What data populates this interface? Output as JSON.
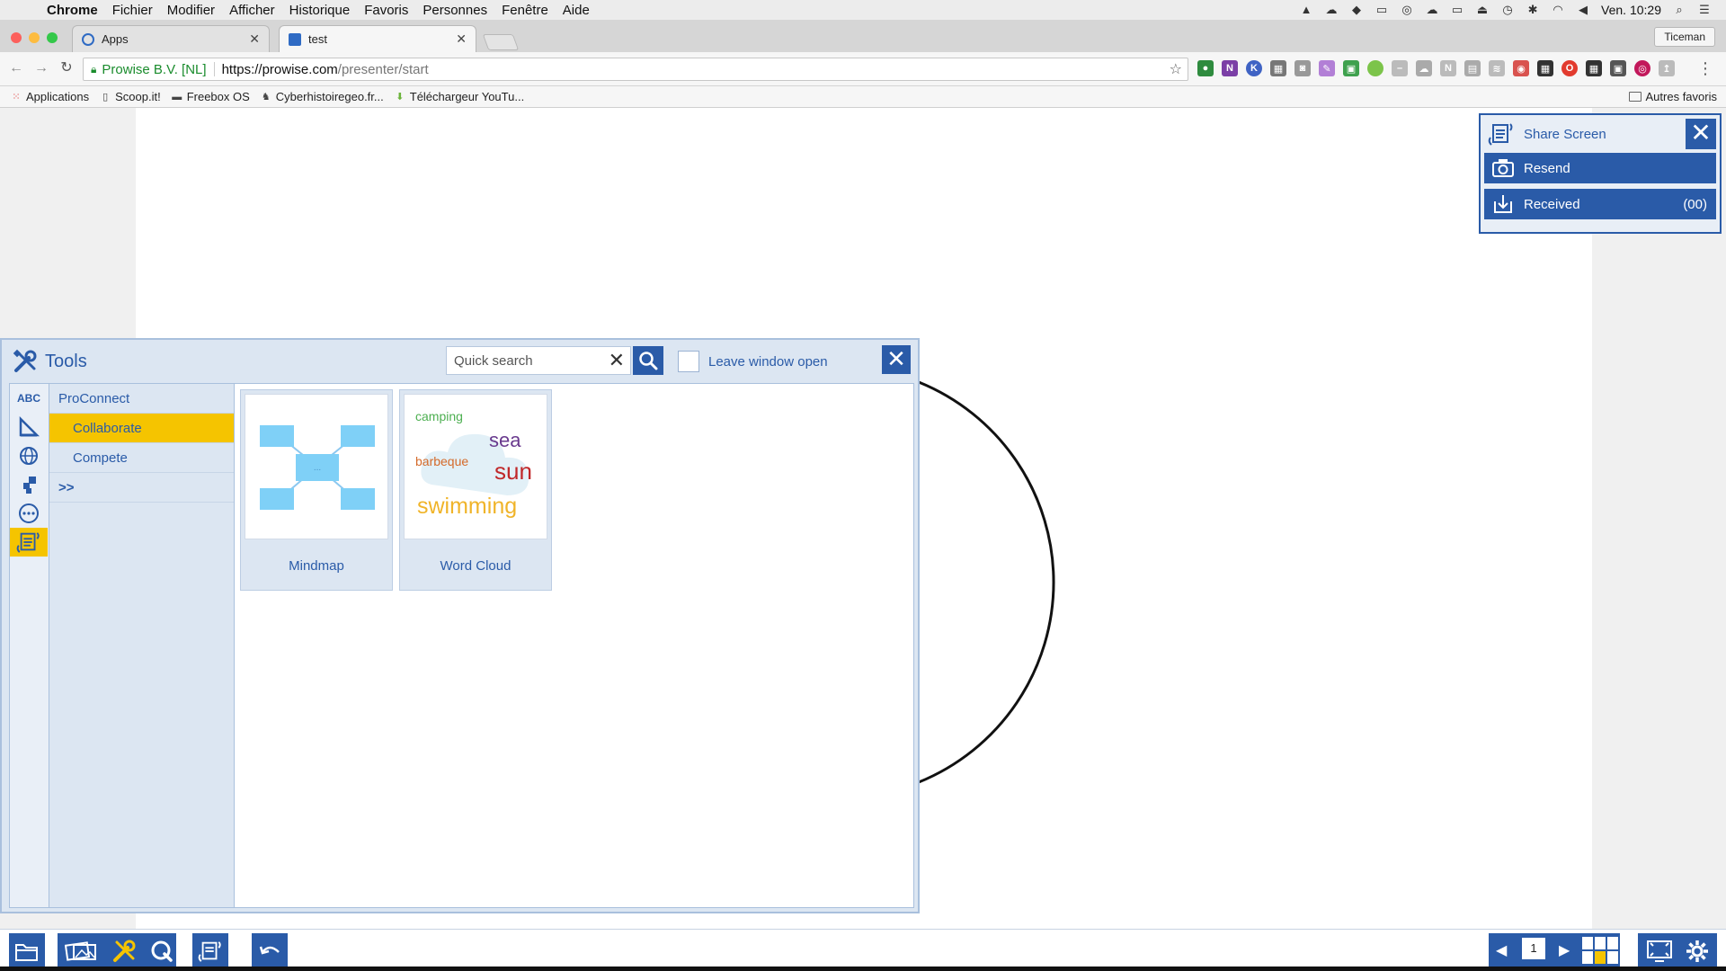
{
  "menubar": {
    "app": "Chrome",
    "items": [
      "Fichier",
      "Modifier",
      "Afficher",
      "Historique",
      "Favoris",
      "Personnes",
      "Fenêtre",
      "Aide"
    ],
    "clock": "Ven. 10:29"
  },
  "tabs": [
    {
      "title": "Apps"
    },
    {
      "title": "test"
    }
  ],
  "profile": "Ticeman",
  "address": {
    "secure_label": "Prowise B.V. [NL]",
    "url_scheme_host": "https://prowise.com",
    "url_path": "/presenter/start"
  },
  "bookmarks": {
    "items": [
      "Applications",
      "Scoop.it!",
      "Freebox OS",
      "Cyberhistoiregeo.fr...",
      "Téléchargeur YouTu..."
    ],
    "other": "Autres favoris"
  },
  "share_panel": {
    "title": "Share Screen",
    "resend": "Resend",
    "received": "Received",
    "received_count": "(00)"
  },
  "tools": {
    "title": "Tools",
    "search_placeholder": "Quick search",
    "leave_open": "Leave window open",
    "side_icons": [
      "ABC"
    ],
    "categories": {
      "head": "ProConnect",
      "items": [
        "Collaborate",
        "Compete"
      ],
      "more": ">>"
    },
    "tiles": [
      {
        "label": "Mindmap"
      },
      {
        "label": "Word Cloud",
        "words": [
          "camping",
          "sea",
          "barbeque",
          "sun",
          "swimming"
        ]
      }
    ]
  },
  "bottombar": {
    "page": "1"
  },
  "colors": {
    "accent": "#2a5ba8",
    "highlight": "#f5c400",
    "panel": "#dce6f2"
  }
}
